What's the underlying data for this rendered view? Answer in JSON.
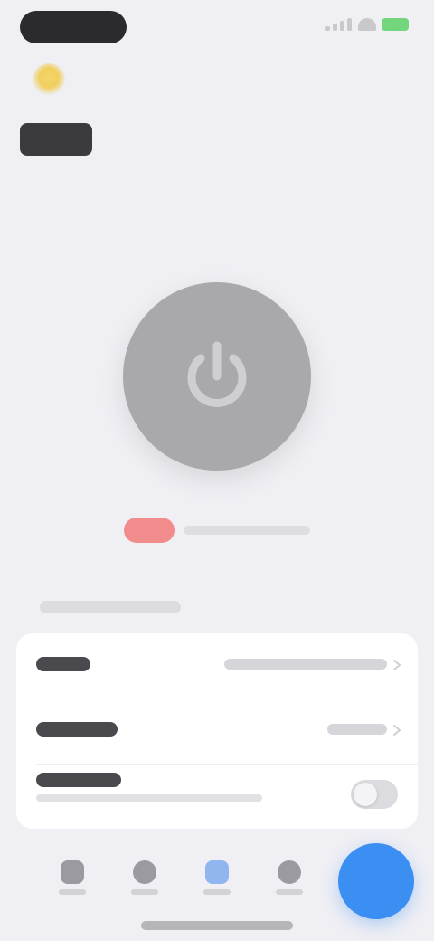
{
  "header": {
    "title": ""
  },
  "power": {
    "icon": "power-icon",
    "state": "off"
  },
  "status": {
    "text": ""
  },
  "settings": {
    "section_title": "",
    "rows": [
      {
        "label": "",
        "value": ""
      },
      {
        "label": "",
        "value": ""
      },
      {
        "label": "",
        "subtitle": "",
        "toggle_on": false
      }
    ]
  },
  "tabbar": {
    "items": [
      {
        "icon": "home-icon",
        "label": ""
      },
      {
        "icon": "person-icon",
        "label": ""
      },
      {
        "icon": "shield-icon",
        "label": "",
        "active": true
      },
      {
        "icon": "gear-icon",
        "label": ""
      }
    ]
  },
  "colors": {
    "background": "#efeff4",
    "power_button": "#a9a9ac",
    "status_badge": "#f28b8b",
    "accent": "#3b8ef2",
    "brand": "#f0cf5e"
  }
}
